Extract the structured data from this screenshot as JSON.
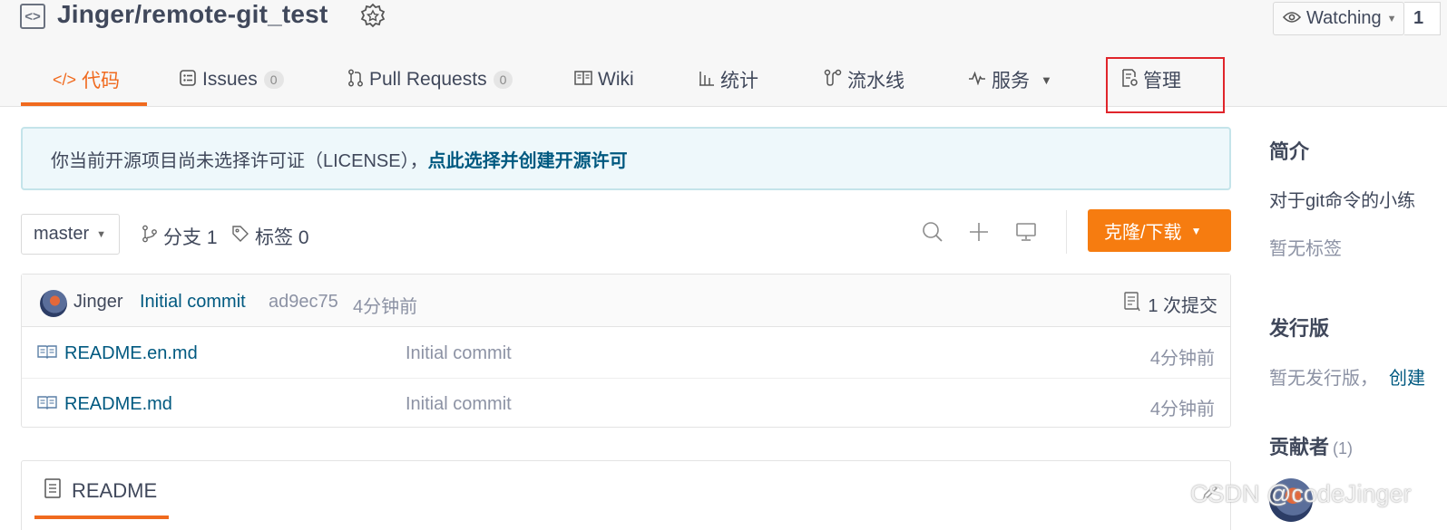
{
  "repo": {
    "title": "Jinger/remote-git_test",
    "watch_label": "Watching",
    "watch_count": "1"
  },
  "tabs": [
    {
      "label": "代码",
      "icon": "code-icon",
      "active": true
    },
    {
      "label": "Issues",
      "icon": "issues-icon",
      "count": "0"
    },
    {
      "label": "Pull Requests",
      "icon": "pull-request-icon",
      "count": "0"
    },
    {
      "label": "Wiki",
      "icon": "wiki-book-icon"
    },
    {
      "label": "统计",
      "icon": "bar-chart-icon"
    },
    {
      "label": "流水线",
      "icon": "pipeline-icon"
    },
    {
      "label": "服务",
      "icon": "pulse-icon"
    },
    {
      "label": "管理",
      "icon": "settings-doc-icon"
    }
  ],
  "license_banner": {
    "text": "你当前开源项目尚未选择许可证（LICENSE），",
    "link": "点此选择并创建开源许可"
  },
  "toolbar": {
    "branch": "master",
    "branches_label": "分支 1",
    "tags_label": "标签 0",
    "clone_label": "克隆/下载"
  },
  "commit": {
    "author": "Jinger",
    "message": "Initial commit",
    "hash": "ad9ec75",
    "time": "4分钟前",
    "count_label": "1 次提交"
  },
  "files": [
    {
      "name": "README.en.md",
      "commit": "Initial commit",
      "time": "4分钟前"
    },
    {
      "name": "README.md",
      "commit": "Initial commit",
      "time": "4分钟前"
    }
  ],
  "readme": {
    "title": "README"
  },
  "sidebar": {
    "intro_heading": "简介",
    "intro_text": "对于git命令的小练",
    "no_tags": "暂无标签",
    "release_heading": "发行版",
    "no_release": "暂无发行版，",
    "create_link": "创建",
    "contributors_heading": "贡献者",
    "contributors_count": "(1)"
  },
  "watermark": "CSDN @codeJinger",
  "colors": {
    "accent": "#f06a1e",
    "clone_button": "#f67c10",
    "link": "#005980",
    "highlight_box": "#e0252b"
  }
}
